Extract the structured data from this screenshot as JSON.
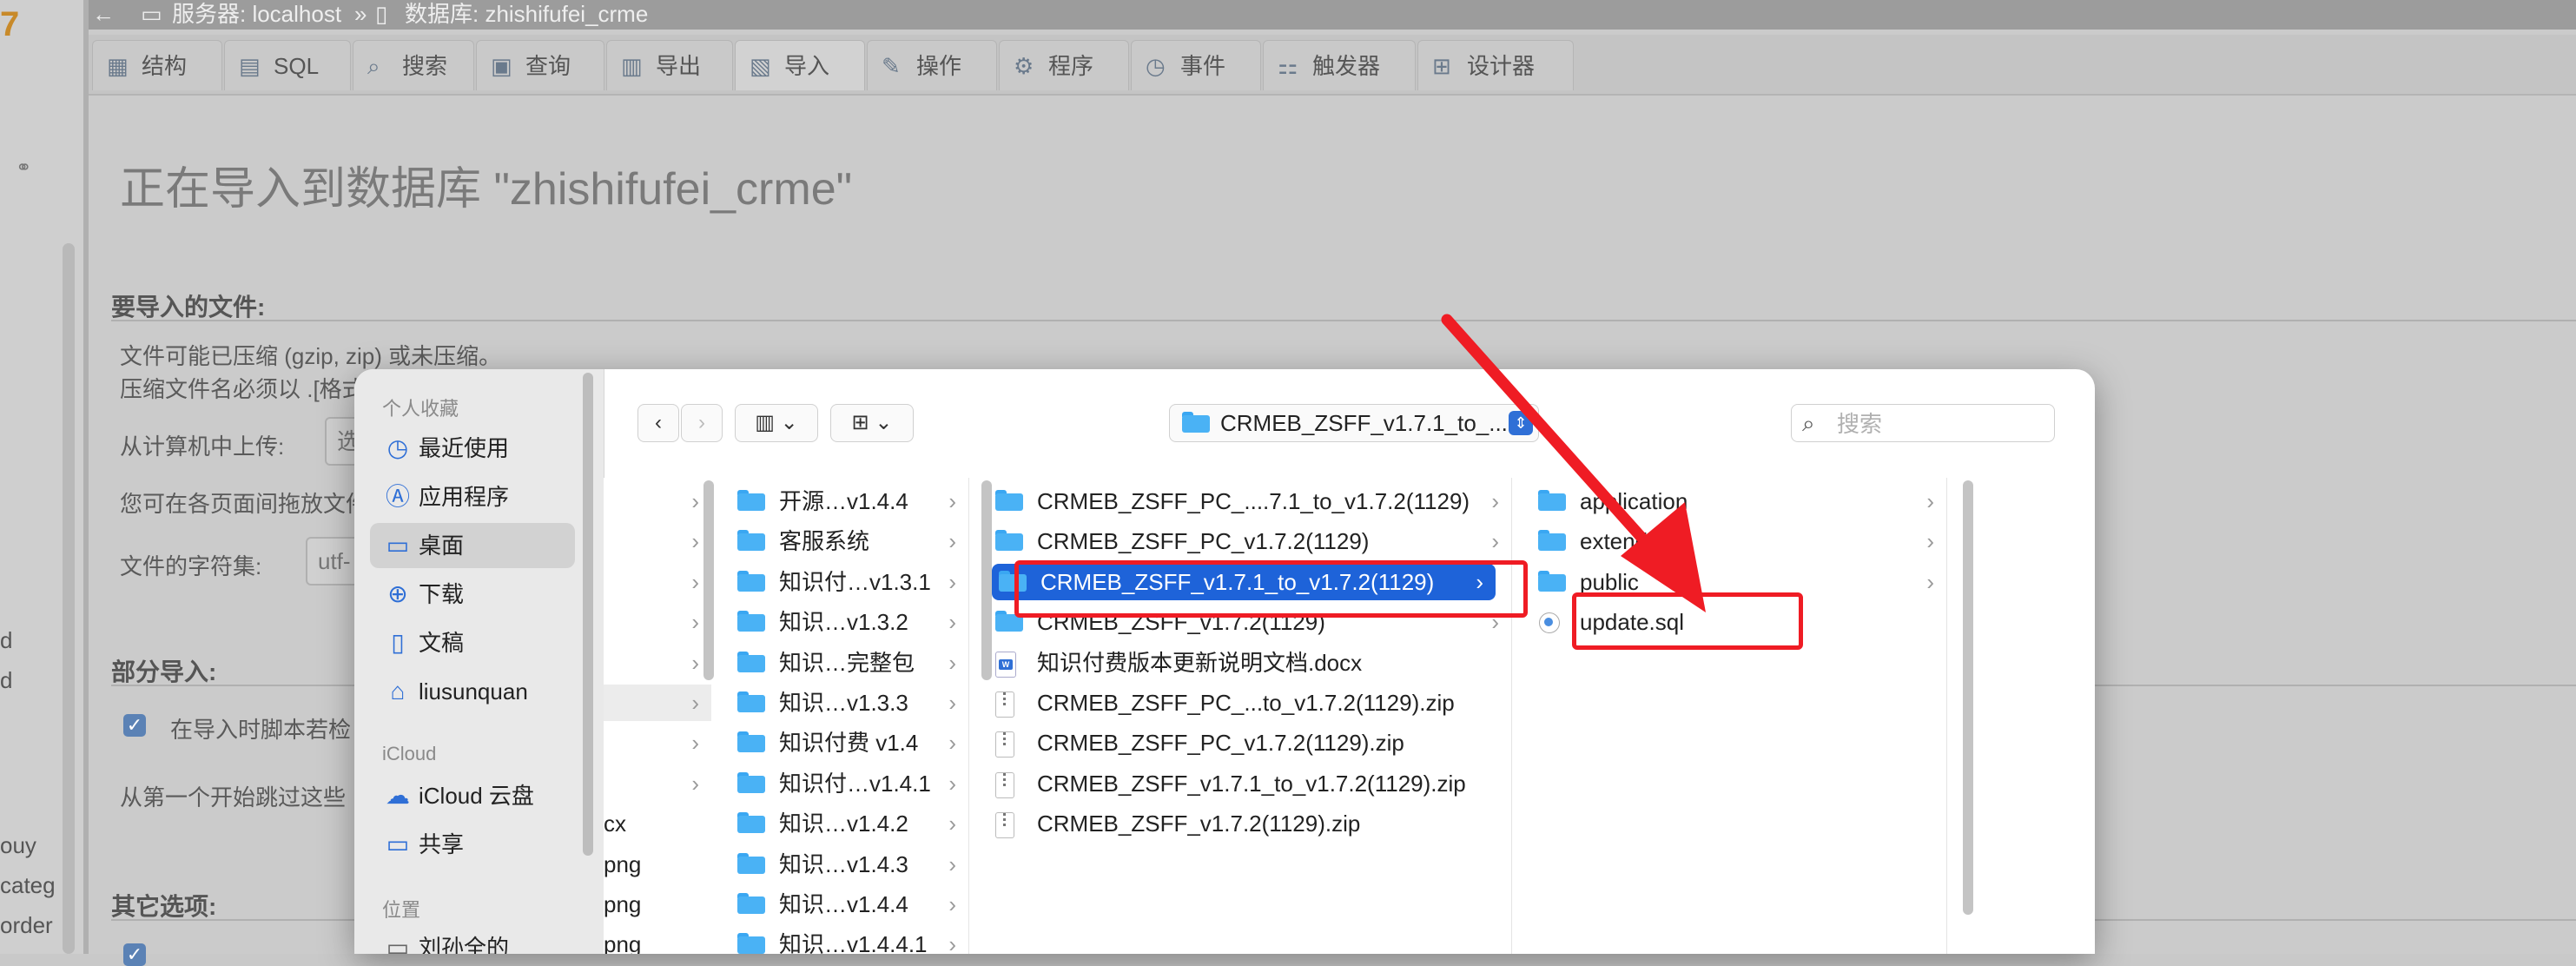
{
  "left_strip": {
    "logo": "7",
    "fragments": [
      "d",
      "d",
      "ouy",
      "categ",
      "order"
    ]
  },
  "breadcrumb": {
    "back": "←",
    "server": "服务器: localhost",
    "separator": "»",
    "database": "数据库: zhishifufei_crme"
  },
  "tabs": [
    {
      "label": "结构",
      "icon": "structure-icon"
    },
    {
      "label": "SQL",
      "icon": "sql-icon"
    },
    {
      "label": "搜索",
      "icon": "search-icon"
    },
    {
      "label": "查询",
      "icon": "query-icon"
    },
    {
      "label": "导出",
      "icon": "export-icon"
    },
    {
      "label": "导入",
      "icon": "import-icon"
    },
    {
      "label": "操作",
      "icon": "wrench-icon"
    },
    {
      "label": "程序",
      "icon": "routines-icon"
    },
    {
      "label": "事件",
      "icon": "clock-icon"
    },
    {
      "label": "触发器",
      "icon": "trigger-icon"
    },
    {
      "label": "设计器",
      "icon": "designer-icon"
    }
  ],
  "page": {
    "heading": "正在导入到数据库 \"zhishifufei_crme\"",
    "file_section_title": "要导入的文件:",
    "compress_line": "文件可能已压缩 (gzip, zip) 或未压缩。",
    "compress_line2": "压缩文件名必须以 .[格式",
    "upload_label": "从计算机中上传:",
    "upload_button": "选",
    "drag_text": "您可在各页面间拖放文件",
    "charset_label": "文件的字符集:",
    "charset_value": "utf-",
    "partial_title": "部分导入:",
    "partial_checkbox": "在导入时脚本若检",
    "skip_text": "从第一个开始跳过这些",
    "other_title": "其它选项:"
  },
  "dialog": {
    "sidebar": {
      "favorites_heading": "个人收藏",
      "favorites": [
        {
          "label": "最近使用",
          "icon": "clock-icon"
        },
        {
          "label": "应用程序",
          "icon": "apps-icon"
        },
        {
          "label": "桌面",
          "icon": "desktop-icon",
          "selected": true
        },
        {
          "label": "下载",
          "icon": "download-icon"
        },
        {
          "label": "文稿",
          "icon": "document-icon"
        },
        {
          "label": "liusunquan",
          "icon": "home-icon"
        }
      ],
      "icloud_heading": "iCloud",
      "icloud": [
        {
          "label": "iCloud 云盘",
          "icon": "cloud-icon"
        },
        {
          "label": "共享",
          "icon": "shared-folder-icon"
        }
      ],
      "locations_heading": "位置",
      "locations": [
        {
          "label": "刘孙全的",
          "icon": "computer-icon"
        }
      ]
    },
    "toolbar": {
      "back": "‹",
      "forward": "›",
      "path": "CRMEB_ZSFF_v1.7.1_to_...",
      "search_placeholder": "搜索"
    },
    "col0": [
      "›",
      "›",
      "›",
      "›",
      "›",
      "›",
      "›",
      "›",
      "cx",
      "png",
      "png",
      "png"
    ],
    "col1": [
      "开源…v1.4.4",
      "客服系统",
      "知识付…v1.3.1",
      "知识…v1.3.2",
      "知识…完整包",
      "知识…v1.3.3",
      "知识付费 v1.4",
      "知识付…v1.4.1",
      "知识…v1.4.2",
      "知识…v1.4.3",
      "知识…v1.4.4",
      "知识…v1.4.4.1"
    ],
    "col2": [
      {
        "label": "CRMEB_ZSFF_PC_....7.1_to_v1.7.2(1129)",
        "type": "folder",
        "chev": true
      },
      {
        "label": "CRMEB_ZSFF_PC_v1.7.2(1129)",
        "type": "folder",
        "chev": true
      },
      {
        "label": "CRMEB_ZSFF_v1.7.1_to_v1.7.2(1129)",
        "type": "folder",
        "chev": true,
        "selected": true
      },
      {
        "label": "CRMEB_ZSFF_v1.7.2(1129)",
        "type": "folder",
        "chev": true
      },
      {
        "label": "知识付费版本更新说明文档.docx",
        "type": "docx",
        "chev": false
      },
      {
        "label": "CRMEB_ZSFF_PC_...to_v1.7.2(1129).zip",
        "type": "zip",
        "chev": false
      },
      {
        "label": "CRMEB_ZSFF_PC_v1.7.2(1129).zip",
        "type": "zip",
        "chev": false
      },
      {
        "label": "CRMEB_ZSFF_v1.7.1_to_v1.7.2(1129).zip",
        "type": "zip",
        "chev": false
      },
      {
        "label": "CRMEB_ZSFF_v1.7.2(1129).zip",
        "type": "zip",
        "chev": false
      }
    ],
    "col3": [
      {
        "label": "application",
        "type": "folder",
        "chev": true
      },
      {
        "label": "extend",
        "type": "folder",
        "chev": true
      },
      {
        "label": "public",
        "type": "folder",
        "chev": true
      },
      {
        "label": "update.sql",
        "type": "sql",
        "chev": false
      }
    ]
  },
  "colors": {
    "annotation_red": "#ef1c24",
    "selection_blue": "#1e63d9",
    "folder_blue": "#4ab2f5"
  }
}
